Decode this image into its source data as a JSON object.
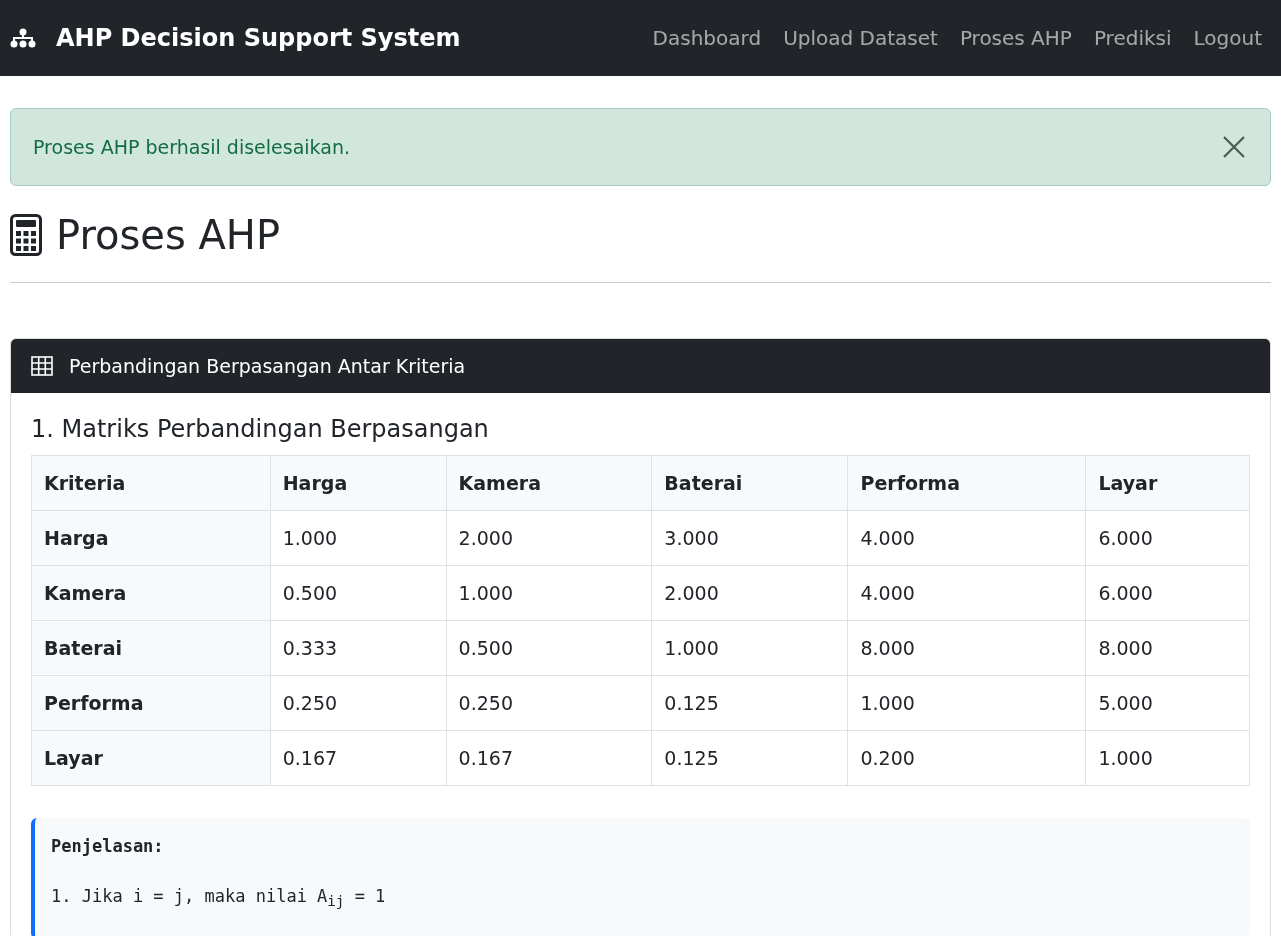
{
  "navbar": {
    "brand": "AHP Decision Support System",
    "links": [
      {
        "label": "Dashboard",
        "selected": false
      },
      {
        "label": "Upload Dataset",
        "selected": false
      },
      {
        "label": "Proses AHP",
        "selected": false
      },
      {
        "label": "Prediksi",
        "selected": false
      },
      {
        "label": "Logout",
        "selected": false
      }
    ]
  },
  "alert": {
    "message": "Proses AHP berhasil diselesaikan."
  },
  "page_title": "Proses AHP",
  "card": {
    "title": "Perbandingan Berpasangan Antar Kriteria",
    "section_title": "1. Matriks Perbandingan Berpasangan",
    "table": {
      "columns": [
        "Kriteria",
        "Harga",
        "Kamera",
        "Baterai",
        "Performa",
        "Layar"
      ],
      "rows": [
        [
          "Harga",
          "1.000",
          "2.000",
          "3.000",
          "4.000",
          "6.000"
        ],
        [
          "Kamera",
          "0.500",
          "1.000",
          "2.000",
          "4.000",
          "6.000"
        ],
        [
          "Baterai",
          "0.333",
          "0.500",
          "1.000",
          "8.000",
          "8.000"
        ],
        [
          "Performa",
          "0.250",
          "0.250",
          "0.125",
          "1.000",
          "5.000"
        ],
        [
          "Layar",
          "0.167",
          "0.167",
          "0.125",
          "0.200",
          "1.000"
        ]
      ]
    },
    "explanation": {
      "heading": "Penjelasan:",
      "lines": [
        "1. Jika i = j, maka nilai A$_{ij}$ = 1"
      ]
    }
  }
}
